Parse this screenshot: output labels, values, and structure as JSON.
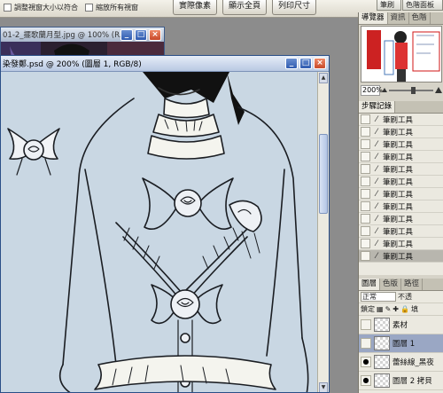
{
  "options_bar": {
    "checkbox1": "調整視窗大小以符合",
    "checkbox2": "縮放所有視窗",
    "buttons": [
      "實際像素",
      "顯示全頁",
      "列印尺寸"
    ],
    "panel_tabs": [
      "筆刷",
      "色階面板"
    ]
  },
  "doc_back": {
    "title": "01-2_擺歌蘭月型.jpg @ 100% (R..."
  },
  "doc_front": {
    "title": "染發鄭.psd @ 200% (圖層 1, RGB/8)"
  },
  "window_buttons": {
    "minimize": "_",
    "maximize": "□",
    "close": "×"
  },
  "navigator": {
    "tabs": [
      "導覽器",
      "資訊",
      "色階"
    ],
    "zoom": "200%"
  },
  "history": {
    "tab": "步驟記錄",
    "items": [
      "筆刷工具",
      "筆刷工具",
      "筆刷工具",
      "筆刷工具",
      "筆刷工具",
      "筆刷工具",
      "筆刷工具",
      "筆刷工具",
      "筆刷工具",
      "筆刷工具",
      "筆刷工具",
      "筆刷工具"
    ]
  },
  "layers": {
    "tabs": [
      "圖層",
      "色版",
      "路徑"
    ],
    "blend_mode": "正常",
    "opacity_label": "不透",
    "lock_label": "鎖定",
    "fill_label": "填",
    "items": [
      {
        "name": "素材",
        "visible": false
      },
      {
        "name": "圖層 1",
        "visible": false
      },
      {
        "name": "蕾絲線_黑夜",
        "visible": true
      },
      {
        "name": "圖層 2 拷貝",
        "visible": true
      }
    ]
  }
}
